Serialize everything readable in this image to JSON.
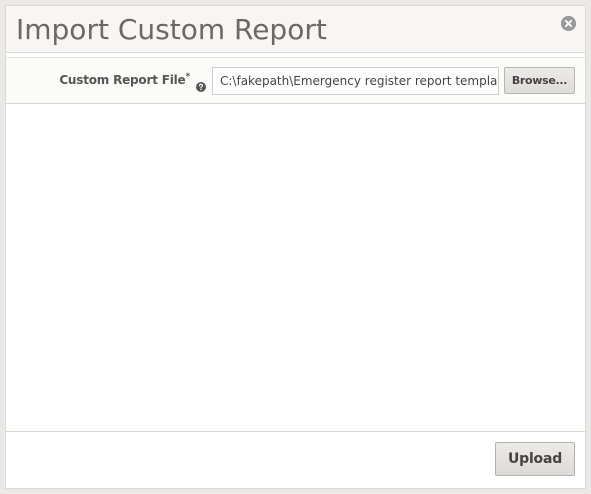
{
  "dialog": {
    "title": "Import Custom Report",
    "close_icon": "close-circle-icon"
  },
  "form": {
    "file_label": "Custom Report File",
    "required_marker": "*",
    "help_icon": "question-circle-icon",
    "file_value": "C:\\fakepath\\Emergency register report template.xml",
    "browse_label": "Browse..."
  },
  "footer": {
    "upload_label": "Upload"
  }
}
